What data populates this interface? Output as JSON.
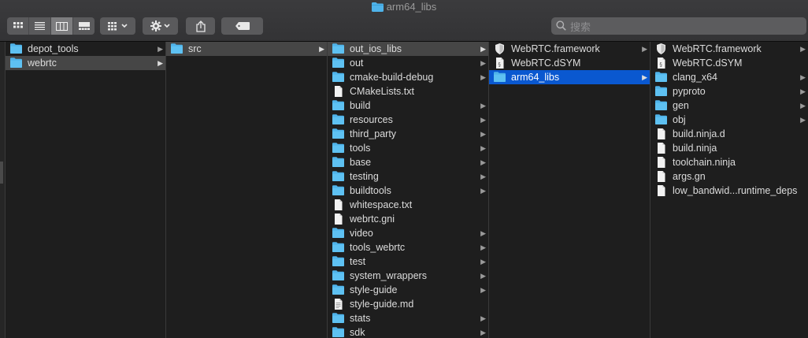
{
  "window": {
    "title": "arm64_libs"
  },
  "toolbar": {
    "view_buttons": [
      "icon-view",
      "list-view",
      "column-view",
      "gallery-view"
    ],
    "selected_view": "column-view"
  },
  "search": {
    "placeholder": "搜索",
    "value": ""
  },
  "columns": [
    {
      "items": [
        {
          "label": "depot_tools",
          "type": "folder",
          "has_children": true,
          "state": "normal"
        },
        {
          "label": "webrtc",
          "type": "folder",
          "has_children": true,
          "state": "highlighted"
        }
      ]
    },
    {
      "items": [
        {
          "label": "src",
          "type": "folder",
          "has_children": true,
          "state": "highlighted"
        }
      ]
    },
    {
      "items": [
        {
          "label": "out_ios_libs",
          "type": "folder",
          "has_children": true,
          "state": "highlighted"
        },
        {
          "label": "out",
          "type": "folder",
          "has_children": true,
          "state": "normal"
        },
        {
          "label": "cmake-build-debug",
          "type": "folder",
          "has_children": true,
          "state": "normal"
        },
        {
          "label": "CMakeLists.txt",
          "type": "file",
          "has_children": false,
          "state": "normal"
        },
        {
          "label": "build",
          "type": "folder",
          "has_children": true,
          "state": "normal"
        },
        {
          "label": "resources",
          "type": "folder",
          "has_children": true,
          "state": "normal"
        },
        {
          "label": "third_party",
          "type": "folder",
          "has_children": true,
          "state": "normal"
        },
        {
          "label": "tools",
          "type": "folder",
          "has_children": true,
          "state": "normal"
        },
        {
          "label": "base",
          "type": "folder",
          "has_children": true,
          "state": "normal"
        },
        {
          "label": "testing",
          "type": "folder",
          "has_children": true,
          "state": "normal"
        },
        {
          "label": "buildtools",
          "type": "folder",
          "has_children": true,
          "state": "normal"
        },
        {
          "label": "whitespace.txt",
          "type": "file",
          "has_children": false,
          "state": "normal"
        },
        {
          "label": "webrtc.gni",
          "type": "file",
          "has_children": false,
          "state": "normal"
        },
        {
          "label": "video",
          "type": "folder",
          "has_children": true,
          "state": "normal"
        },
        {
          "label": "tools_webrtc",
          "type": "folder",
          "has_children": true,
          "state": "normal"
        },
        {
          "label": "test",
          "type": "folder",
          "has_children": true,
          "state": "normal"
        },
        {
          "label": "system_wrappers",
          "type": "folder",
          "has_children": true,
          "state": "normal"
        },
        {
          "label": "style-guide",
          "type": "folder",
          "has_children": true,
          "state": "normal"
        },
        {
          "label": "style-guide.md",
          "type": "doc",
          "has_children": false,
          "state": "normal"
        },
        {
          "label": "stats",
          "type": "folder",
          "has_children": true,
          "state": "normal"
        },
        {
          "label": "sdk",
          "type": "folder",
          "has_children": true,
          "state": "normal"
        }
      ]
    },
    {
      "items": [
        {
          "label": "WebRTC.framework",
          "type": "framework",
          "has_children": true,
          "state": "normal"
        },
        {
          "label": "WebRTC.dSYM",
          "type": "dsym",
          "has_children": false,
          "state": "normal"
        },
        {
          "label": "arm64_libs",
          "type": "folder",
          "has_children": true,
          "state": "selected"
        }
      ]
    },
    {
      "items": [
        {
          "label": "WebRTC.framework",
          "type": "framework",
          "has_children": true,
          "state": "normal"
        },
        {
          "label": "WebRTC.dSYM",
          "type": "dsym",
          "has_children": false,
          "state": "normal"
        },
        {
          "label": "clang_x64",
          "type": "folder",
          "has_children": true,
          "state": "normal"
        },
        {
          "label": "pyproto",
          "type": "folder",
          "has_children": true,
          "state": "normal"
        },
        {
          "label": "gen",
          "type": "folder",
          "has_children": true,
          "state": "normal"
        },
        {
          "label": "obj",
          "type": "folder",
          "has_children": true,
          "state": "normal"
        },
        {
          "label": "build.ninja.d",
          "type": "file",
          "has_children": false,
          "state": "normal"
        },
        {
          "label": "build.ninja",
          "type": "file",
          "has_children": false,
          "state": "normal"
        },
        {
          "label": "toolchain.ninja",
          "type": "file",
          "has_children": false,
          "state": "normal"
        },
        {
          "label": "args.gn",
          "type": "file",
          "has_children": false,
          "state": "normal"
        },
        {
          "label": "low_bandwid...runtime_deps",
          "type": "file",
          "has_children": false,
          "state": "normal"
        }
      ]
    }
  ],
  "colors": {
    "folder": "#4fb3ea",
    "selection": "#0a58d0",
    "highlight": "#464646",
    "background": "#1e1e1e"
  }
}
